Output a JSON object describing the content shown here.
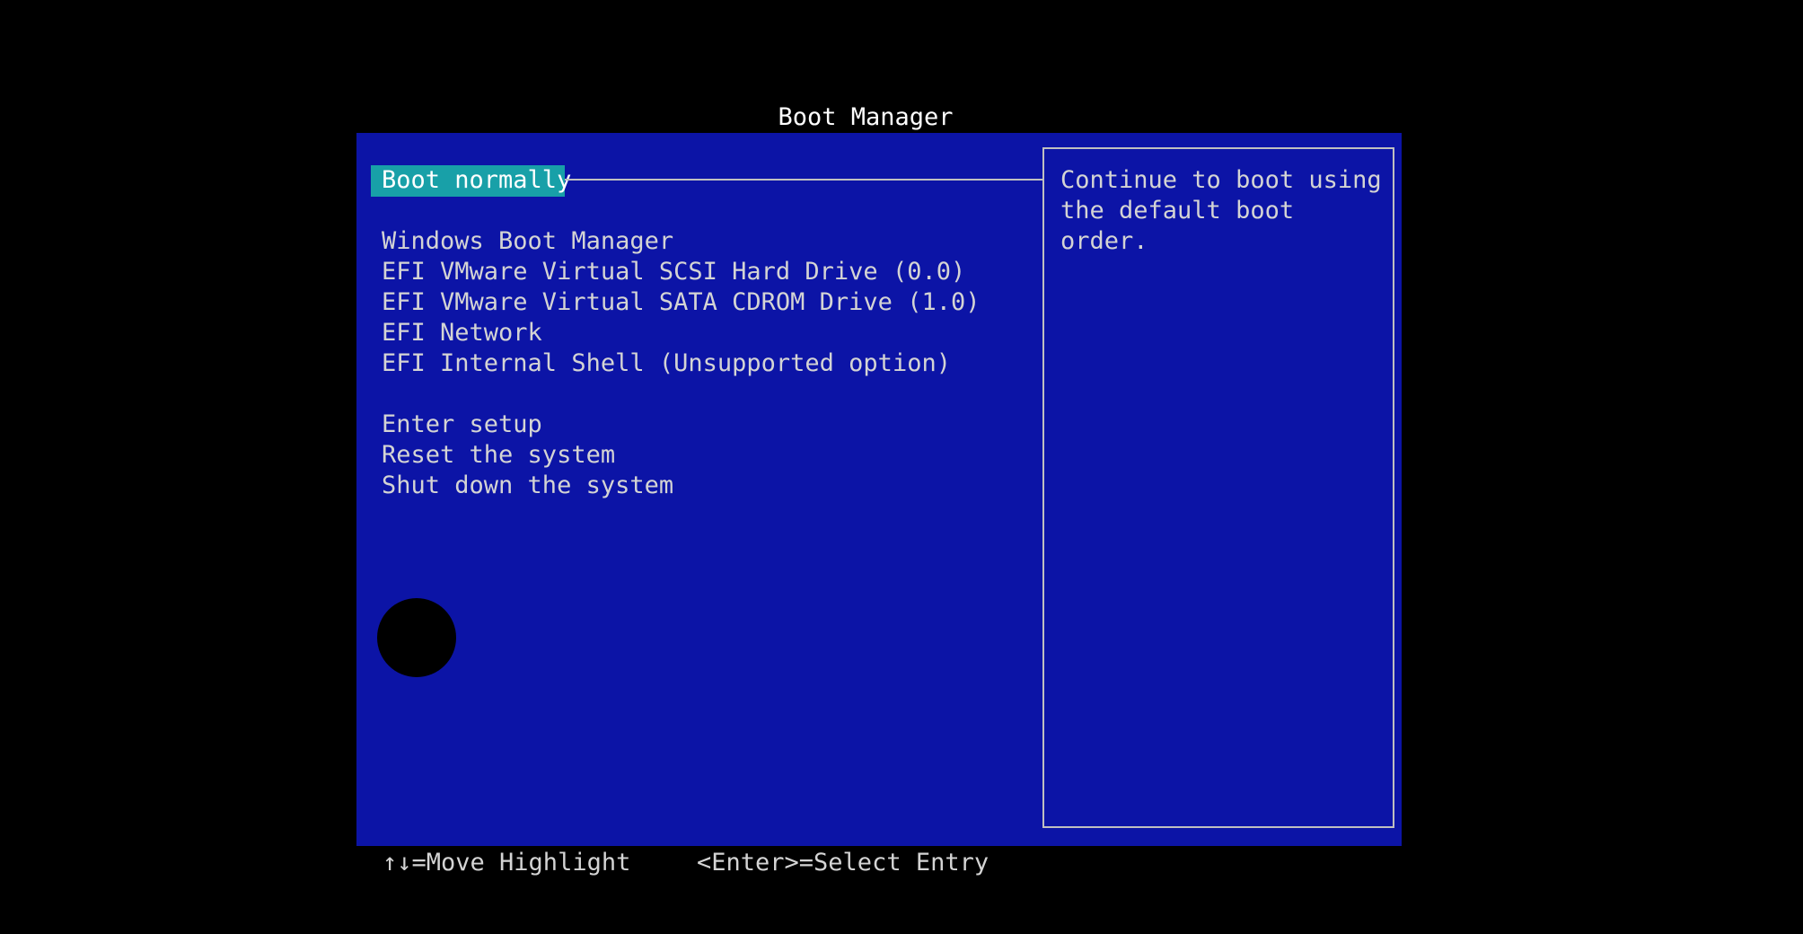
{
  "title": "Boot Manager",
  "colors": {
    "panel_bg": "#0c14a6",
    "highlight_bg": "#18a0a8",
    "text": "#d4d4d4",
    "border": "#c0c0c0"
  },
  "menu": {
    "selected": "Boot normally",
    "boot_entries": [
      "Windows Boot Manager",
      "EFI VMware Virtual SCSI Hard Drive (0.0)",
      "EFI VMware Virtual SATA CDROM Drive (1.0)",
      "EFI Network",
      "EFI Internal Shell (Unsupported option)"
    ],
    "system_entries": [
      "Enter setup",
      "Reset the system",
      "Shut down the system"
    ]
  },
  "help": {
    "text": "Continue to boot using\nthe default boot order."
  },
  "footer": {
    "move_hint": "↑↓=Move Highlight",
    "select_hint": "<Enter>=Select Entry"
  }
}
